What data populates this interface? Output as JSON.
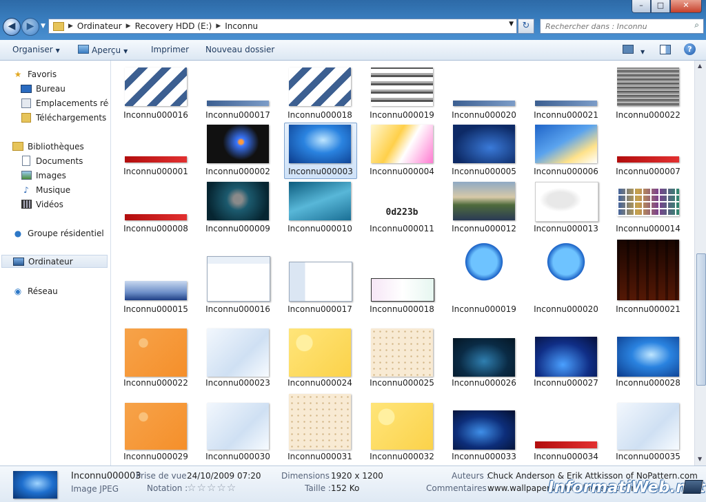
{
  "window": {
    "minimize": "–",
    "maximize": "□",
    "close": "✕"
  },
  "address": {
    "crumbs": [
      "Ordinateur",
      "Recovery HDD (E:)",
      "Inconnu"
    ]
  },
  "search": {
    "placeholder": "Rechercher dans : Inconnu"
  },
  "toolbar": {
    "organize": "Organiser",
    "preview": "Aperçu",
    "print": "Imprimer",
    "new_folder": "Nouveau dossier"
  },
  "sidebar": {
    "favorites": "Favoris",
    "desktop": "Bureau",
    "recent": "Emplacements récents",
    "downloads": "Téléchargements",
    "libraries": "Bibliothèques",
    "documents": "Documents",
    "images": "Images",
    "music": "Musique",
    "videos": "Vidéos",
    "homegroup": "Groupe résidentiel",
    "computer": "Ordinateur",
    "network": "Réseau"
  },
  "files": {
    "row0": [
      "Inconnu000016",
      "Inconnu000017",
      "Inconnu000018",
      "Inconnu000019",
      "Inconnu000020",
      "Inconnu000021",
      "Inconnu000022"
    ],
    "row1": [
      "Inconnu000001",
      "Inconnu000002",
      "Inconnu000003",
      "Inconnu000004",
      "Inconnu000005",
      "Inconnu000006",
      "Inconnu000007"
    ],
    "row2": [
      "Inconnu000008",
      "Inconnu000009",
      "Inconnu000010",
      "Inconnu000011",
      "Inconnu000012",
      "Inconnu000013",
      "Inconnu000014"
    ],
    "row3": [
      "Inconnu000015",
      "Inconnu000016",
      "Inconnu000017",
      "Inconnu000018",
      "Inconnu000019",
      "Inconnu000020",
      "Inconnu000021"
    ],
    "row4": [
      "Inconnu000022",
      "Inconnu000023",
      "Inconnu000024",
      "Inconnu000025",
      "Inconnu000026",
      "Inconnu000027",
      "Inconnu000028"
    ],
    "row5": [
      "Inconnu000029",
      "Inconnu000030",
      "Inconnu000031",
      "Inconnu000032",
      "Inconnu000033",
      "Inconnu000034",
      "Inconnu000035"
    ],
    "selected": "Inconnu000003",
    "thumb_text_11": "0d223b"
  },
  "details": {
    "name": "Inconnu000003",
    "type": "Image JPEG",
    "taken_label": "Prise de vue :",
    "taken_value": "24/10/2009 07:20",
    "rating_label": "Notation :",
    "rating_stars": "☆☆☆☆☆",
    "rating_value": 0,
    "dimensions_label": "Dimensions :",
    "dimensions_value": "1920 x 1200",
    "size_label": "Taille :",
    "size_value": "152 Ko",
    "authors_label": "Auteurs :",
    "authors_value": "Chuck Anderson & Erik Attkisson of NoPattern.com",
    "comments_label": "Commentaires :",
    "comments_value": "www.wallpapersxplore.blogspot.com"
  },
  "watermark": "InformatiWeb.net",
  "colors": {
    "selection": "#cfe2f8",
    "title_bar": "#3c82c4",
    "toolbar": "#dce7f3"
  }
}
